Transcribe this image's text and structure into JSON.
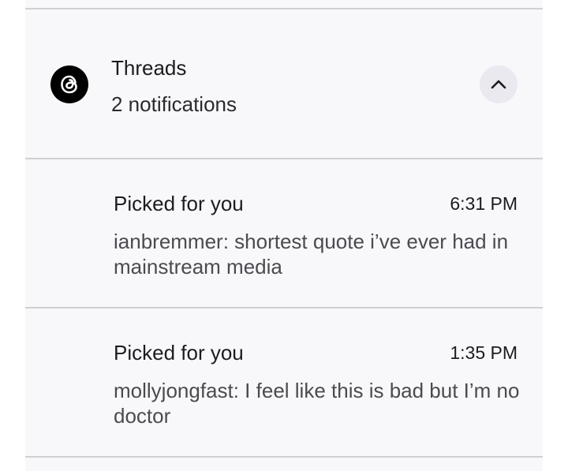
{
  "group": {
    "app_name": "Threads",
    "summary": "2 notifications",
    "icon": "threads-logo-icon",
    "collapse_icon": "chevron-up-icon"
  },
  "notifications": [
    {
      "title": "Picked for you",
      "time": "6:31 PM",
      "body": "ianbremmer: shortest quote i’ve ever had in mainstream media"
    },
    {
      "title": "Picked for you",
      "time": "1:35 PM",
      "body": "mollyjongfast: I feel like this is bad but I’m no doctor"
    }
  ],
  "colors": {
    "panel_bg": "#f8f8fb",
    "divider": "#cfd0d4",
    "icon_bg": "#000000",
    "button_bg": "#e9e9ef"
  }
}
